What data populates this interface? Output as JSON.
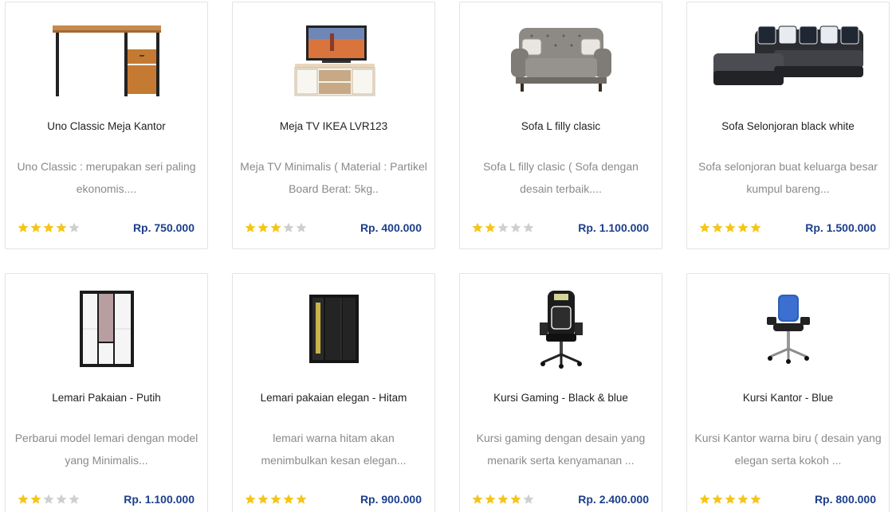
{
  "colors": {
    "star_on": "#f5c518",
    "star_off": "#cfcfcf",
    "price": "#1d3f8a"
  },
  "products": [
    {
      "name": "Uno Classic Meja Kantor",
      "desc": "Uno Classic : merupakan seri paling ekonomis....",
      "rating": 4,
      "price": "Rp. 750.000",
      "image": "office-desk"
    },
    {
      "name": "Meja TV IKEA LVR123",
      "desc": "Meja TV Minimalis ( Material : Partikel Board Berat: 5kg..",
      "rating": 3,
      "price": "Rp. 400.000",
      "image": "tv-stand"
    },
    {
      "name": "Sofa L filly clasic",
      "desc": "Sofa L filly clasic ( Sofa dengan desain terbaik....",
      "rating": 2,
      "price": "Rp. 1.100.000",
      "image": "classic-sofa"
    },
    {
      "name": "Sofa Selonjoran black white",
      "desc": "Sofa selonjoran buat keluarga besar kumpul bareng...",
      "rating": 5,
      "price": "Rp. 1.500.000",
      "image": "l-sofa"
    },
    {
      "name": "Lemari Pakaian - Putih",
      "desc": "Perbarui model lemari dengan model yang Minimalis...",
      "rating": 2,
      "price": "Rp. 1.100.000",
      "image": "white-wardrobe"
    },
    {
      "name": "Lemari pakaian elegan - Hitam",
      "desc": "lemari warna hitam akan menimbulkan kesan elegan...",
      "rating": 5,
      "price": "Rp. 900.000",
      "image": "black-wardrobe"
    },
    {
      "name": "Kursi Gaming - Black & blue",
      "desc": "Kursi gaming dengan desain yang menarik serta kenyamanan ...",
      "rating": 4,
      "price": "Rp. 2.400.000",
      "image": "gaming-chair"
    },
    {
      "name": "Kursi Kantor - Blue",
      "desc": "Kursi Kantor warna biru ( desain yang elegan serta kokoh ...",
      "rating": 5,
      "price": "Rp. 800.000",
      "image": "office-chair"
    }
  ]
}
